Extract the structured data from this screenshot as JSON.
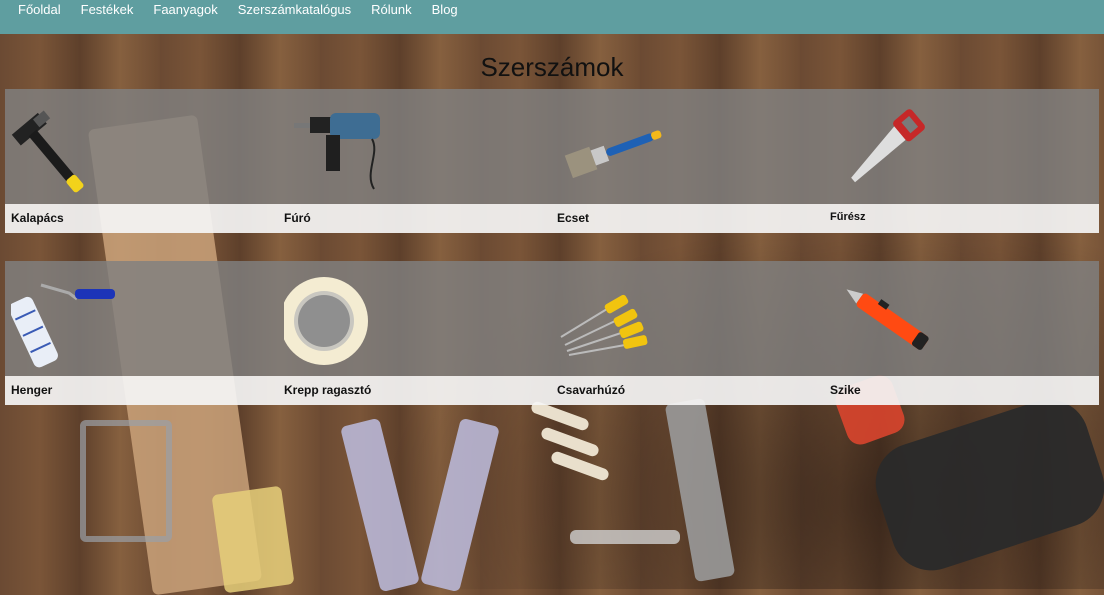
{
  "nav": {
    "items": [
      {
        "label": "Főoldal"
      },
      {
        "label": "Festékek"
      },
      {
        "label": "Faanyagok"
      },
      {
        "label": "Szerszámkatalógus"
      },
      {
        "label": "Rólunk"
      },
      {
        "label": "Blog"
      }
    ]
  },
  "page": {
    "title": "Szerszámok"
  },
  "tools": [
    {
      "name": "Kalapács",
      "icon": "hammer-icon"
    },
    {
      "name": "Fúró",
      "icon": "drill-icon"
    },
    {
      "name": "Ecset",
      "icon": "brush-icon"
    },
    {
      "name": "Fűrész",
      "icon": "saw-icon"
    },
    {
      "name": "Henger",
      "icon": "roller-icon"
    },
    {
      "name": "Krepp ragasztó",
      "icon": "tape-icon"
    },
    {
      "name": "Csavarhúzó",
      "icon": "screwdriver-icon"
    },
    {
      "name": "Szike",
      "icon": "cutter-knife-icon"
    }
  ],
  "colors": {
    "nav_bg": "#5f9ea0",
    "card_band": "#808080",
    "label_band": "#f5f5f5"
  }
}
